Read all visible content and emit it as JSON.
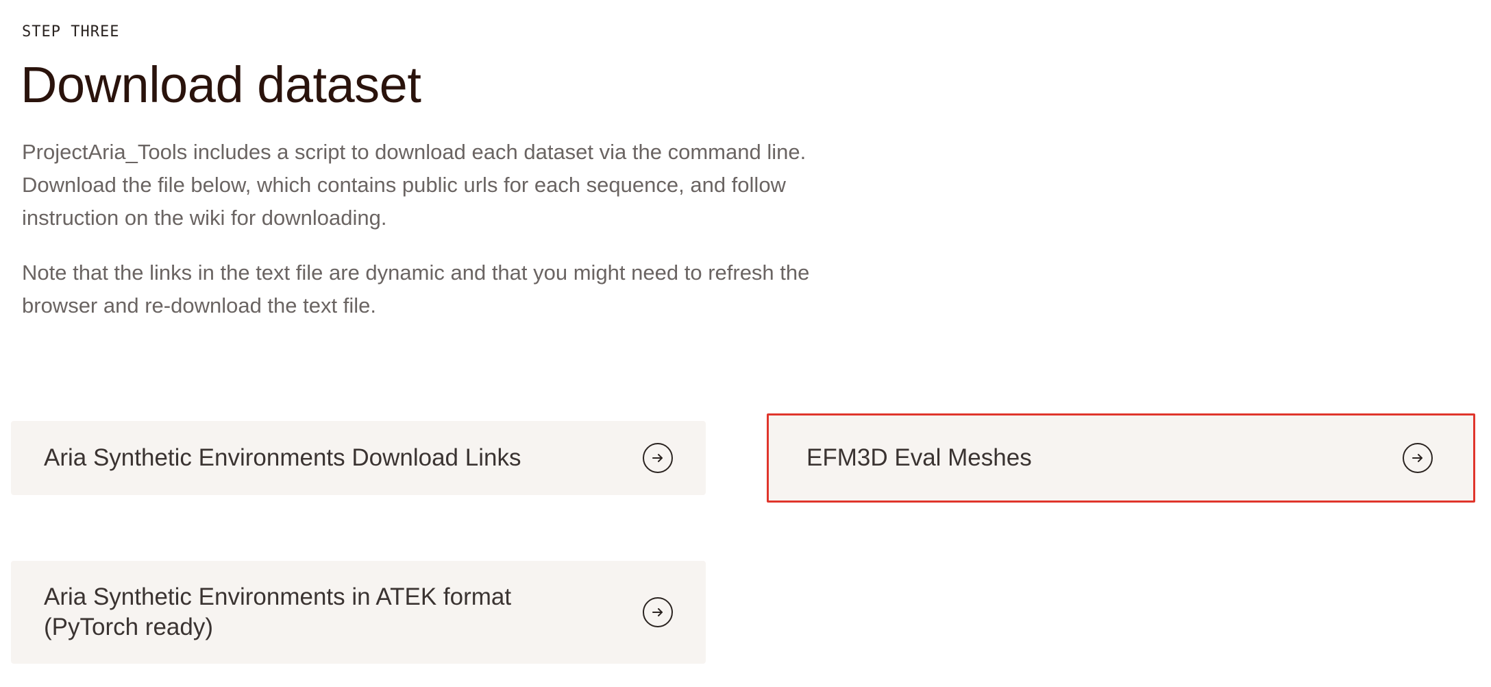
{
  "header": {
    "step_label": "STEP THREE",
    "title": "Download dataset"
  },
  "intro": {
    "paragraph_1": "ProjectAria_Tools includes a script to download each dataset via the command line. Download the file below, which contains public urls for each sequence, and follow instruction on the wiki for downloading.",
    "paragraph_2": "Note that the links in the text file are dynamic and that you might need to refresh the browser and re-download the text file."
  },
  "downloads": [
    {
      "label": "Aria Synthetic Environments Download Links",
      "icon": "arrow-right-circle-icon"
    },
    {
      "label": "EFM3D Eval Meshes",
      "icon": "arrow-right-circle-icon",
      "highlighted": true
    },
    {
      "label": "Aria Synthetic Environments in ATEK format (PyTorch ready)",
      "icon": "arrow-right-circle-icon"
    }
  ],
  "colors": {
    "title": "#2a130c",
    "body_text": "#6a6462",
    "card_background": "#f7f4f1",
    "highlight_border": "#e0352b"
  }
}
